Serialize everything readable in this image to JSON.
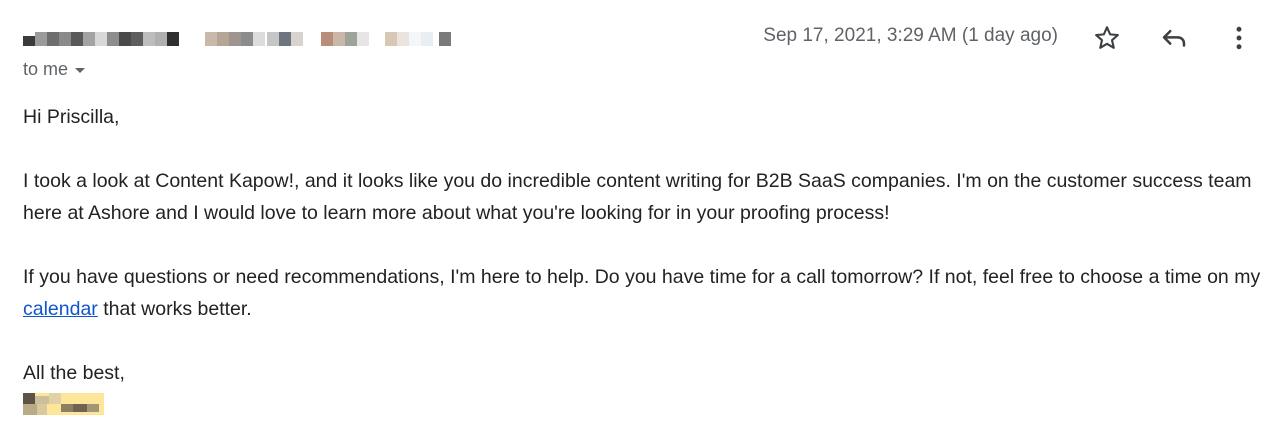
{
  "header": {
    "recipient_label": "to me",
    "date": "Sep 17, 2021, 3:29 AM (1 day ago)",
    "icons": {
      "star": "star-outline-icon",
      "reply": "reply-icon",
      "more": "more-vert-icon"
    }
  },
  "message": {
    "greeting": "Hi Priscilla,",
    "paragraph1": "I took a look at Content Kapow!, and it looks like you do incredible content writing for B2B SaaS companies. I'm on the customer success team here at Ashore and I would love to learn more about what you're looking for in your proofing process!",
    "paragraph2_before_link": "If you have questions or need recommendations, I'm here to help. Do you have time for a call tomorrow? If not, feel free to choose a time on my ",
    "paragraph2_link": "calendar",
    "paragraph2_after_link": " that works better.",
    "closing": "All the best,"
  },
  "colors": {
    "link": "#1155cc",
    "muted_text": "#5f6368",
    "body_text": "#222222",
    "signature_highlight": "#fde59a"
  }
}
